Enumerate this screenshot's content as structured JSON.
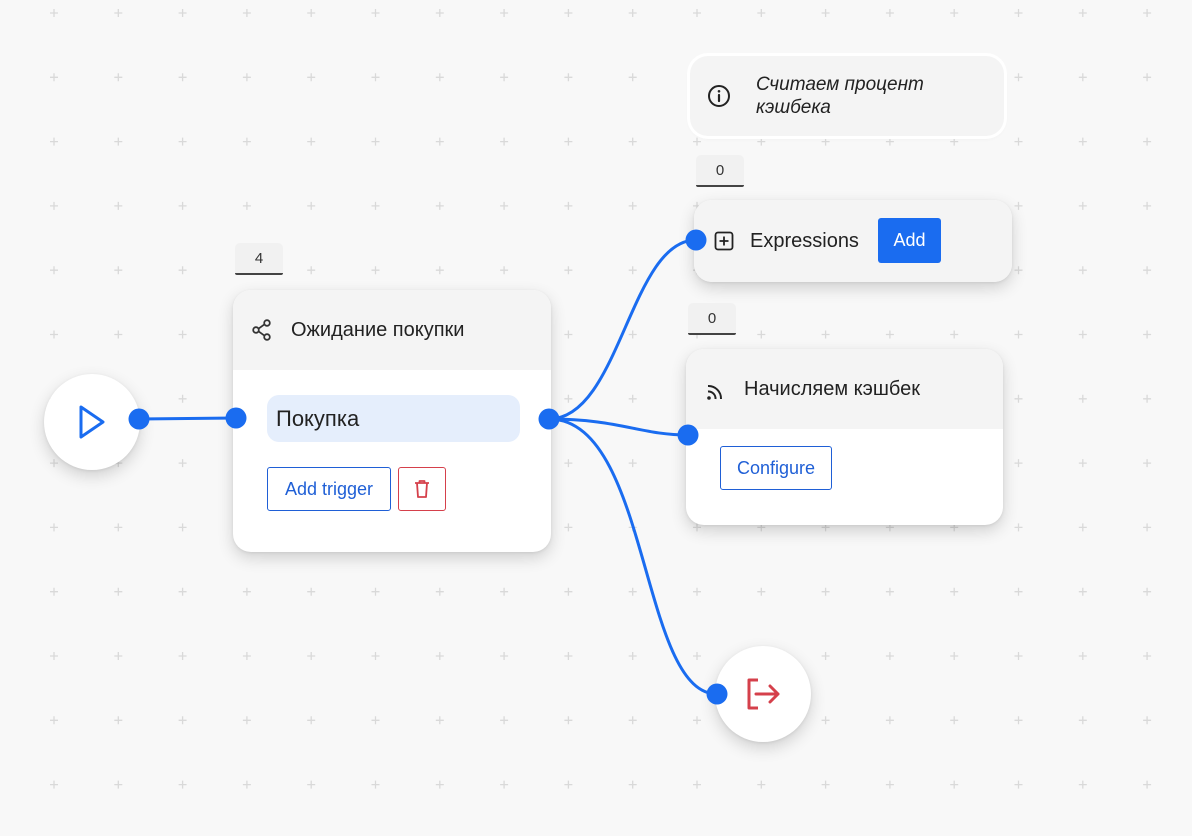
{
  "colors": {
    "accent": "#1a6cf0",
    "danger": "#d5404b",
    "edge": "#1a6cf0"
  },
  "start": {
    "icon": "play-icon"
  },
  "exit": {
    "icon": "exit-icon"
  },
  "wait_node": {
    "badge": "4",
    "icon": "share-icon",
    "title": "Ожидание покупки",
    "trigger_label": "Покупка",
    "add_trigger_label": "Add trigger",
    "delete_icon": "trash-icon"
  },
  "note": {
    "icon": "info-icon",
    "text": "Считаем процент кэшбека"
  },
  "expressions_node": {
    "badge": "0",
    "icon": "plus-square-icon",
    "title": "Expressions",
    "add_label": "Add"
  },
  "cashback_node": {
    "badge": "0",
    "icon": "rss-icon",
    "title": "Начисляем кэшбек",
    "configure_label": "Configure"
  }
}
